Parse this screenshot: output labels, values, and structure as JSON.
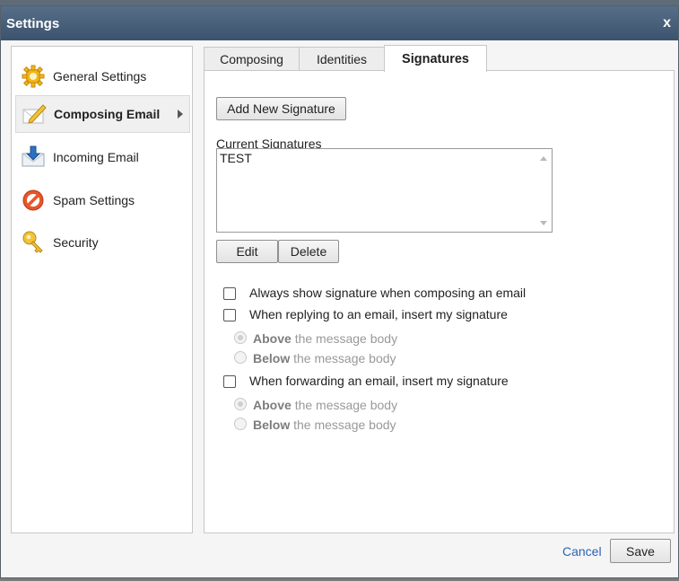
{
  "window": {
    "title": "Settings",
    "close_label": "x"
  },
  "sidebar": {
    "items": [
      {
        "label": "General Settings",
        "icon": "gear-icon"
      },
      {
        "label": "Composing Email",
        "icon": "compose-icon",
        "active": true
      },
      {
        "label": "Incoming Email",
        "icon": "inbox-icon"
      },
      {
        "label": "Spam Settings",
        "icon": "no-entry-icon"
      },
      {
        "label": "Security",
        "icon": "key-icon"
      }
    ]
  },
  "tabs": [
    {
      "label": "Composing"
    },
    {
      "label": "Identities"
    },
    {
      "label": "Signatures",
      "active": true
    }
  ],
  "signatures": {
    "add_button": "Add New Signature",
    "list_label": "Current Signatures",
    "items": [
      "TEST"
    ],
    "edit_button": "Edit",
    "delete_button": "Delete"
  },
  "options": {
    "always_show": "Always show signature when composing an email",
    "reply_insert": "When replying to an email, insert my signature",
    "forward_insert": "When forwarding an email, insert my signature",
    "above_bold": "Above",
    "below_bold": "Below",
    "rest": "the message body"
  },
  "footer": {
    "cancel": "Cancel",
    "save": "Save"
  },
  "colors": {
    "titlebar": "#3c536d",
    "link": "#2a64b2"
  }
}
